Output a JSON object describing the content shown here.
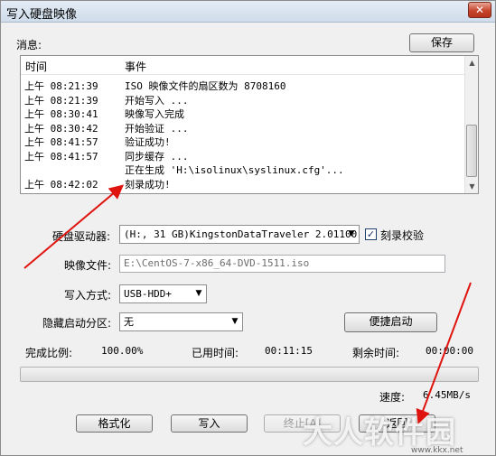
{
  "window": {
    "title": "写入硬盘映像",
    "close_glyph": "✕"
  },
  "messages": {
    "label": "消息:",
    "save_label": "保存",
    "columns": {
      "time": "时间",
      "event": "事件"
    },
    "rows": [
      {
        "time": "上午 08:21:39",
        "event": "ISO 映像文件的扇区数为 8708160"
      },
      {
        "time": "上午 08:21:39",
        "event": "开始写入 ..."
      },
      {
        "time": "上午 08:30:41",
        "event": "映像写入完成"
      },
      {
        "time": "上午 08:30:42",
        "event": "开始验证 ..."
      },
      {
        "time": "上午 08:41:57",
        "event": "验证成功!"
      },
      {
        "time": "上午 08:41:57",
        "event": "同步缓存 ..."
      },
      {
        "time": "",
        "event": "正在生成 'H:\\isolinux\\syslinux.cfg'..."
      },
      {
        "time": "上午 08:42:02",
        "event": "刻录成功!"
      }
    ]
  },
  "form": {
    "drive_label": "硬盘驱动器:",
    "drive_value": "(H:, 31 GB)KingstonDataTraveler 2.01100",
    "verify_label": "刻录校验",
    "verify_checked": "✓",
    "image_label": "映像文件:",
    "image_value": "E:\\CentOS-7-x86_64-DVD-1511.iso",
    "write_mode_label": "写入方式:",
    "write_mode_value": "USB-HDD+",
    "hidden_partition_label": "隐藏启动分区:",
    "hidden_partition_value": "无",
    "quick_boot_label": "便捷启动"
  },
  "stats": {
    "completion_label": "完成比例:",
    "completion_value": "100.00%",
    "elapsed_label": "已用时间:",
    "elapsed_value": "00:11:15",
    "remaining_label": "剩余时间:",
    "remaining_value": "00:00:00",
    "speed_label": "速度:",
    "speed_value": "6.45MB/s"
  },
  "buttons": {
    "format": "格式化",
    "write": "写入",
    "stop": "终止[A]",
    "back": "返回"
  },
  "watermark": {
    "text": "大人软件园",
    "url": "www.kkx.net"
  },
  "colors": {
    "annotation_arrow": "#e0140e",
    "close_button": "#c7452c"
  }
}
